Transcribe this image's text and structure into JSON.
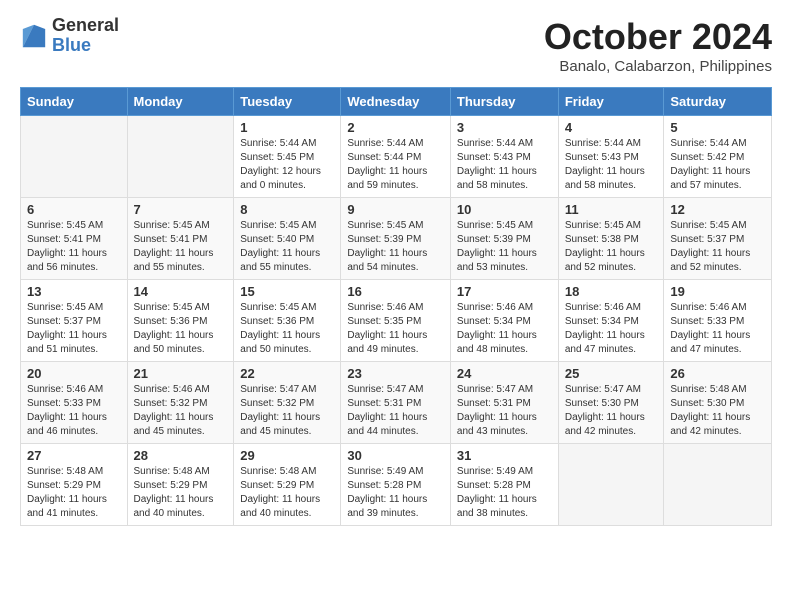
{
  "logo": {
    "general": "General",
    "blue": "Blue"
  },
  "title": "October 2024",
  "subtitle": "Banalo, Calabarzon, Philippines",
  "headers": [
    "Sunday",
    "Monday",
    "Tuesday",
    "Wednesday",
    "Thursday",
    "Friday",
    "Saturday"
  ],
  "weeks": [
    [
      {
        "day": "",
        "info": ""
      },
      {
        "day": "",
        "info": ""
      },
      {
        "day": "1",
        "info": "Sunrise: 5:44 AM\nSunset: 5:45 PM\nDaylight: 12 hours\nand 0 minutes."
      },
      {
        "day": "2",
        "info": "Sunrise: 5:44 AM\nSunset: 5:44 PM\nDaylight: 11 hours\nand 59 minutes."
      },
      {
        "day": "3",
        "info": "Sunrise: 5:44 AM\nSunset: 5:43 PM\nDaylight: 11 hours\nand 58 minutes."
      },
      {
        "day": "4",
        "info": "Sunrise: 5:44 AM\nSunset: 5:43 PM\nDaylight: 11 hours\nand 58 minutes."
      },
      {
        "day": "5",
        "info": "Sunrise: 5:44 AM\nSunset: 5:42 PM\nDaylight: 11 hours\nand 57 minutes."
      }
    ],
    [
      {
        "day": "6",
        "info": "Sunrise: 5:45 AM\nSunset: 5:41 PM\nDaylight: 11 hours\nand 56 minutes."
      },
      {
        "day": "7",
        "info": "Sunrise: 5:45 AM\nSunset: 5:41 PM\nDaylight: 11 hours\nand 55 minutes."
      },
      {
        "day": "8",
        "info": "Sunrise: 5:45 AM\nSunset: 5:40 PM\nDaylight: 11 hours\nand 55 minutes."
      },
      {
        "day": "9",
        "info": "Sunrise: 5:45 AM\nSunset: 5:39 PM\nDaylight: 11 hours\nand 54 minutes."
      },
      {
        "day": "10",
        "info": "Sunrise: 5:45 AM\nSunset: 5:39 PM\nDaylight: 11 hours\nand 53 minutes."
      },
      {
        "day": "11",
        "info": "Sunrise: 5:45 AM\nSunset: 5:38 PM\nDaylight: 11 hours\nand 52 minutes."
      },
      {
        "day": "12",
        "info": "Sunrise: 5:45 AM\nSunset: 5:37 PM\nDaylight: 11 hours\nand 52 minutes."
      }
    ],
    [
      {
        "day": "13",
        "info": "Sunrise: 5:45 AM\nSunset: 5:37 PM\nDaylight: 11 hours\nand 51 minutes."
      },
      {
        "day": "14",
        "info": "Sunrise: 5:45 AM\nSunset: 5:36 PM\nDaylight: 11 hours\nand 50 minutes."
      },
      {
        "day": "15",
        "info": "Sunrise: 5:45 AM\nSunset: 5:36 PM\nDaylight: 11 hours\nand 50 minutes."
      },
      {
        "day": "16",
        "info": "Sunrise: 5:46 AM\nSunset: 5:35 PM\nDaylight: 11 hours\nand 49 minutes."
      },
      {
        "day": "17",
        "info": "Sunrise: 5:46 AM\nSunset: 5:34 PM\nDaylight: 11 hours\nand 48 minutes."
      },
      {
        "day": "18",
        "info": "Sunrise: 5:46 AM\nSunset: 5:34 PM\nDaylight: 11 hours\nand 47 minutes."
      },
      {
        "day": "19",
        "info": "Sunrise: 5:46 AM\nSunset: 5:33 PM\nDaylight: 11 hours\nand 47 minutes."
      }
    ],
    [
      {
        "day": "20",
        "info": "Sunrise: 5:46 AM\nSunset: 5:33 PM\nDaylight: 11 hours\nand 46 minutes."
      },
      {
        "day": "21",
        "info": "Sunrise: 5:46 AM\nSunset: 5:32 PM\nDaylight: 11 hours\nand 45 minutes."
      },
      {
        "day": "22",
        "info": "Sunrise: 5:47 AM\nSunset: 5:32 PM\nDaylight: 11 hours\nand 45 minutes."
      },
      {
        "day": "23",
        "info": "Sunrise: 5:47 AM\nSunset: 5:31 PM\nDaylight: 11 hours\nand 44 minutes."
      },
      {
        "day": "24",
        "info": "Sunrise: 5:47 AM\nSunset: 5:31 PM\nDaylight: 11 hours\nand 43 minutes."
      },
      {
        "day": "25",
        "info": "Sunrise: 5:47 AM\nSunset: 5:30 PM\nDaylight: 11 hours\nand 42 minutes."
      },
      {
        "day": "26",
        "info": "Sunrise: 5:48 AM\nSunset: 5:30 PM\nDaylight: 11 hours\nand 42 minutes."
      }
    ],
    [
      {
        "day": "27",
        "info": "Sunrise: 5:48 AM\nSunset: 5:29 PM\nDaylight: 11 hours\nand 41 minutes."
      },
      {
        "day": "28",
        "info": "Sunrise: 5:48 AM\nSunset: 5:29 PM\nDaylight: 11 hours\nand 40 minutes."
      },
      {
        "day": "29",
        "info": "Sunrise: 5:48 AM\nSunset: 5:29 PM\nDaylight: 11 hours\nand 40 minutes."
      },
      {
        "day": "30",
        "info": "Sunrise: 5:49 AM\nSunset: 5:28 PM\nDaylight: 11 hours\nand 39 minutes."
      },
      {
        "day": "31",
        "info": "Sunrise: 5:49 AM\nSunset: 5:28 PM\nDaylight: 11 hours\nand 38 minutes."
      },
      {
        "day": "",
        "info": ""
      },
      {
        "day": "",
        "info": ""
      }
    ]
  ]
}
